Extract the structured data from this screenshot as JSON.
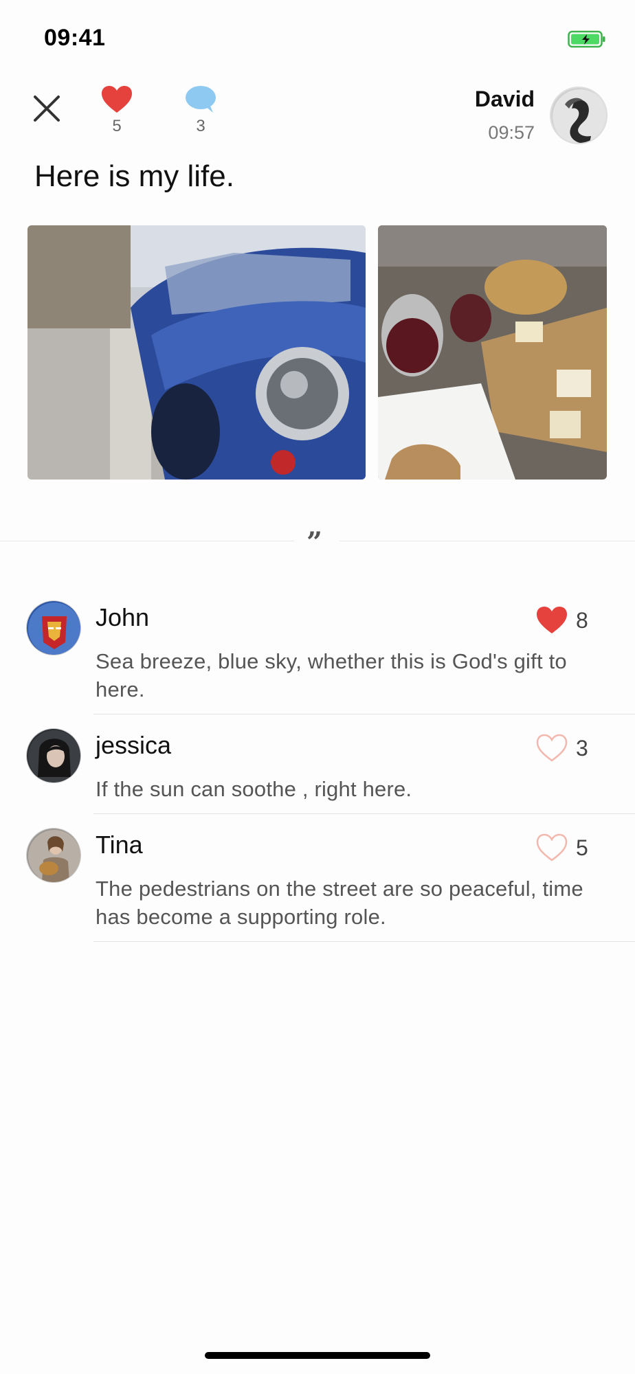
{
  "status_bar": {
    "time": "09:41",
    "battery_icon": "battery-charging-icon",
    "battery_color": "#4cd964"
  },
  "header": {
    "close_icon": "close-icon",
    "likes": {
      "icon": "heart-filled-icon",
      "count": "5",
      "color": "#e5413d"
    },
    "comments": {
      "icon": "chat-bubble-icon",
      "count": "3",
      "color": "#8ec9f2"
    },
    "author": {
      "name": "David",
      "time": "09:57"
    }
  },
  "post": {
    "text": "Here is my life.",
    "photos": [
      {
        "subject": "blue vintage convertible car on a street"
      },
      {
        "subject": "wine glasses, bread and cheese on a table"
      }
    ]
  },
  "divider": {
    "icon": "quote-icon"
  },
  "comments": [
    {
      "name": "John",
      "text": "Sea breeze, blue sky, whether this is God's gift to here.",
      "likes": "8",
      "liked": true
    },
    {
      "name": "jessica",
      "text": "If the sun can soothe , right here.",
      "likes": "3",
      "liked": false
    },
    {
      "name": "Tina",
      "text": "The pedestrians on the street are so peaceful, time has become a supporting role.",
      "likes": "5",
      "liked": false
    }
  ],
  "colors": {
    "heart_active": "#e5413d",
    "heart_inactive": "#f2b8ad",
    "accent_blue": "#8ec9f2"
  }
}
